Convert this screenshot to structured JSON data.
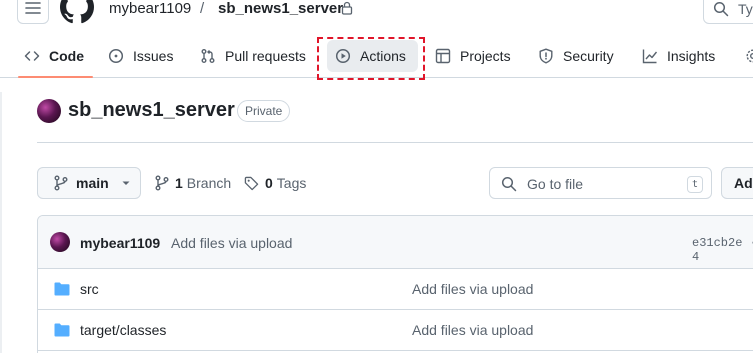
{
  "header": {
    "owner": "mybear1109",
    "separator": "/",
    "repo": "sb_news1_server",
    "search_placeholder": "Ty"
  },
  "nav": {
    "tabs": [
      {
        "label": "Code",
        "icon": "code-icon",
        "selected": true
      },
      {
        "label": "Issues",
        "icon": "issue-icon"
      },
      {
        "label": "Pull requests",
        "icon": "pull-request-icon"
      },
      {
        "label": "Actions",
        "icon": "play-icon",
        "highlighted": true
      },
      {
        "label": "Projects",
        "icon": "table-icon"
      },
      {
        "label": "Security",
        "icon": "shield-icon"
      },
      {
        "label": "Insights",
        "icon": "graph-icon"
      }
    ]
  },
  "repo": {
    "name": "sb_news1_server",
    "visibility": "Private"
  },
  "branch": {
    "current": "main",
    "branch_count": "1",
    "branch_label": "Branch",
    "tag_count": "0",
    "tag_label": "Tags"
  },
  "goto_file": {
    "placeholder": "Go to file",
    "shortcut": "t"
  },
  "add_button": "Add",
  "latest_commit": {
    "author": "mybear1109",
    "message": "Add files via upload",
    "sha": "e31cb2e · 4"
  },
  "files": [
    {
      "name": "src",
      "message": "Add files via upload",
      "type": "folder"
    },
    {
      "name": "target/classes",
      "message": "Add files via upload",
      "type": "folder"
    }
  ],
  "colors": {
    "accent_underline": "#fd8c73",
    "highlight": "#e0152a",
    "folder": "#54aeff"
  }
}
